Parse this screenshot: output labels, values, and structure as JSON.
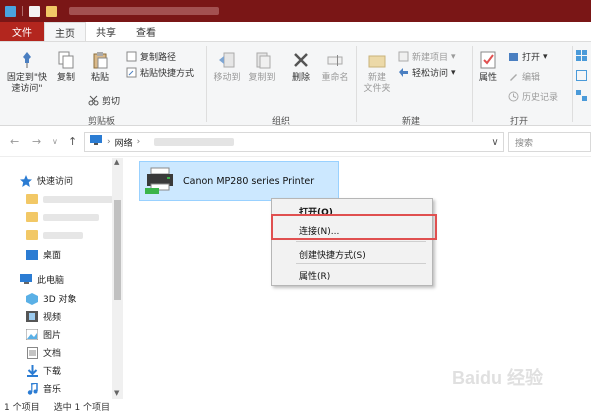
{
  "tabs": {
    "file": "文件",
    "home": "主页",
    "share": "共享",
    "view": "查看"
  },
  "ribbon": {
    "pin_label_1": "固定到\"快",
    "pin_label_2": "速访问\"",
    "copy": "复制",
    "paste": "粘贴",
    "copy_path": "复制路径",
    "paste_shortcut": "粘贴快捷方式",
    "cut": "剪切",
    "group_clipboard": "剪贴板",
    "move_to": "移动到",
    "copy_to": "复制到",
    "delete": "删除",
    "rename": "重命名",
    "group_organize": "组织",
    "new_folder_1": "新建",
    "new_folder_2": "文件夹",
    "new_item": "新建项目",
    "easy_access": "轻松访问",
    "group_new": "新建",
    "properties": "属性",
    "open": "打开",
    "edit": "编辑",
    "history": "历史记录",
    "group_open": "打开"
  },
  "address": {
    "location": "网络",
    "search_placeholder": "搜索"
  },
  "sidebar": {
    "quick_access": "快速访问",
    "desktop": "桌面",
    "this_pc": "此电脑",
    "objects3d": "3D 对象",
    "videos": "视频",
    "pictures": "图片",
    "documents": "文档",
    "downloads": "下载",
    "music": "音乐"
  },
  "content": {
    "printer_name": "Canon MP280 series Printer"
  },
  "context_menu": {
    "open": "打开(O)",
    "connect": "连接(N)...",
    "create_shortcut": "创建快捷方式(S)",
    "properties": "属性(R)"
  },
  "status": {
    "count": "1 个项目",
    "selected": "选中 1 个项目"
  },
  "watermark": "Baidu 经验"
}
